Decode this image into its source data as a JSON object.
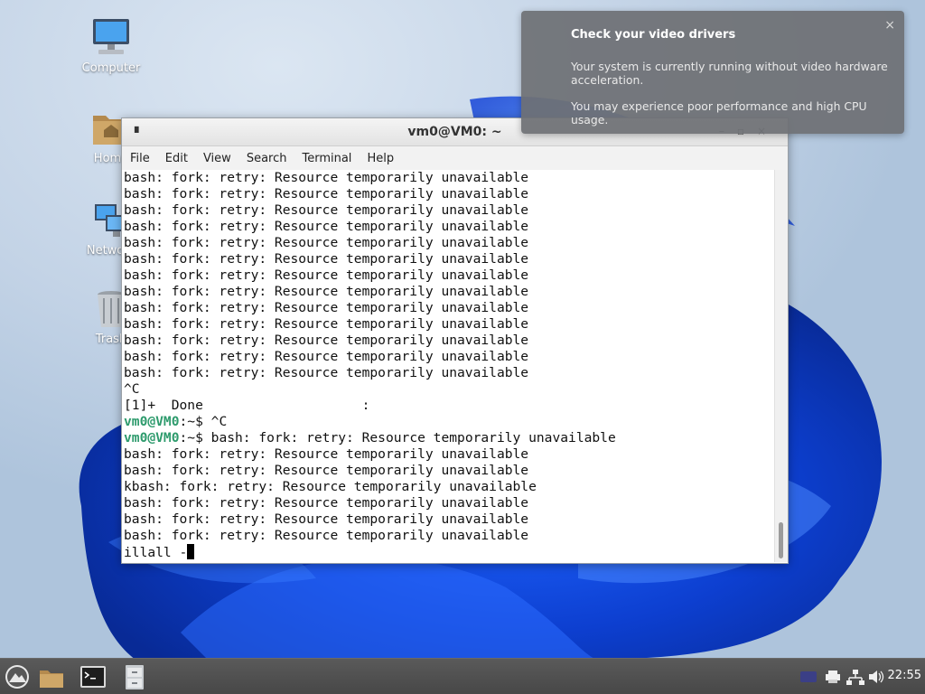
{
  "desktop": {
    "icons": [
      {
        "label": "Computer"
      },
      {
        "label": "Home"
      },
      {
        "label": "Network"
      },
      {
        "label": "Trash"
      }
    ]
  },
  "terminal": {
    "title": "vm0@VM0: ~",
    "menu": [
      "File",
      "Edit",
      "View",
      "Search",
      "Terminal",
      "Help"
    ],
    "lines": [
      {
        "text": "bash: fork: retry: Resource temporarily unavailable"
      },
      {
        "text": "bash: fork: retry: Resource temporarily unavailable"
      },
      {
        "text": "bash: fork: retry: Resource temporarily unavailable"
      },
      {
        "text": "bash: fork: retry: Resource temporarily unavailable"
      },
      {
        "text": "bash: fork: retry: Resource temporarily unavailable"
      },
      {
        "text": "bash: fork: retry: Resource temporarily unavailable"
      },
      {
        "text": "bash: fork: retry: Resource temporarily unavailable"
      },
      {
        "text": "bash: fork: retry: Resource temporarily unavailable"
      },
      {
        "text": "bash: fork: retry: Resource temporarily unavailable"
      },
      {
        "text": "bash: fork: retry: Resource temporarily unavailable"
      },
      {
        "text": "bash: fork: retry: Resource temporarily unavailable"
      },
      {
        "text": "bash: fork: retry: Resource temporarily unavailable"
      },
      {
        "text": "bash: fork: retry: Resource temporarily unavailable"
      },
      {
        "text": "^C"
      },
      {
        "text": "[1]+  Done                    :"
      },
      {
        "prompt": "vm0@VM0",
        "text": ":~$ ^C"
      },
      {
        "prompt": "vm0@VM0",
        "text": ":~$ bash: fork: retry: Resource temporarily unavailable"
      },
      {
        "text": "bash: fork: retry: Resource temporarily unavailable"
      },
      {
        "text": "bash: fork: retry: Resource temporarily unavailable"
      },
      {
        "text": "kbash: fork: retry: Resource temporarily unavailable"
      },
      {
        "text": "bash: fork: retry: Resource temporarily unavailable"
      },
      {
        "text": "bash: fork: retry: Resource temporarily unavailable"
      },
      {
        "text": "bash: fork: retry: Resource temporarily unavailable"
      },
      {
        "text": "illall -",
        "cursor": true
      }
    ]
  },
  "notification": {
    "title": "Check your video drivers",
    "body": [
      "Your system is currently running without video hardware acceleration.",
      "You may experience poor performance and high CPU usage."
    ],
    "close_glyph": "×"
  },
  "taskbar": {
    "clock": "22:55"
  },
  "colors": {
    "prompt": "#2e9b6d",
    "taskbar": "#4f4f4f",
    "notification_bg": "#6e7074"
  }
}
